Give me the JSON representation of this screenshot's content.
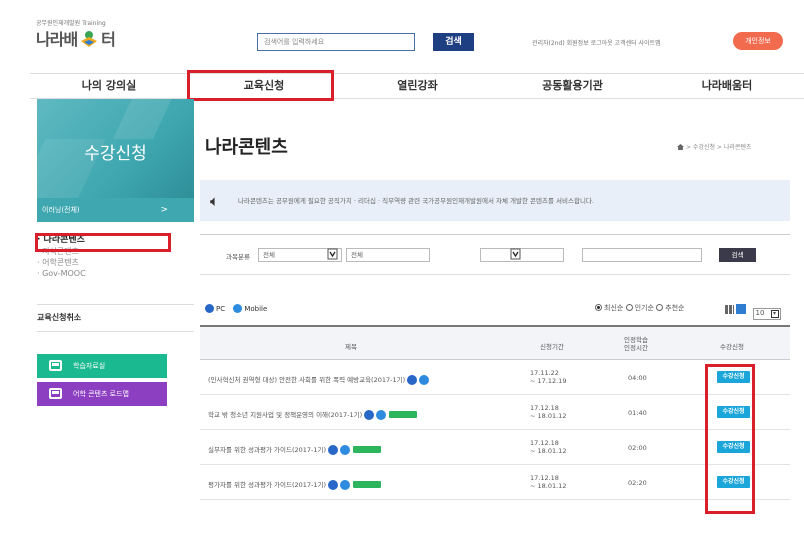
{
  "header": {
    "logo_small": "공무원인재개발원 Training",
    "logo_text_left": "나라배",
    "logo_text_right": "터",
    "search_placeholder": "검색어를 입력하세요",
    "search_button": "검색",
    "top_links": "관리자(2nd) 회원정보 로그아웃 고객센터 사이트맵",
    "login_button": "개인정보"
  },
  "main_nav": [
    "나의 강의실",
    "교육신청",
    "열린강좌",
    "공동활용기관",
    "나라배움터"
  ],
  "sidebar": {
    "banner_title": "수강신청",
    "select_label": "이러닝(전체)",
    "select_chevron": ">",
    "links": [
      "· 나라콘텐츠",
      "· 지식콘텐츠",
      "· 어학콘텐츠",
      "· Gov-MOOC"
    ],
    "cancel_label": "교육신청취소",
    "btn_learning": "학습자료실",
    "btn_language": "어학 콘텐츠 로드맵"
  },
  "content": {
    "page_title": "나라콘텐츠",
    "breadcrumb": "> 수강신청 > 나라콘텐츠",
    "notice": "나라콘텐츠는 공무원에게 필요한 공직가치 · 리더십 · 직무역량 관련 국가공무원인재개발원에서 자체 개발한 콘텐츠를 서비스합니다.",
    "filter_label": "과목분류",
    "filter_select_1": "전체",
    "filter_select_2": "전체",
    "filter_search_btn": "검색",
    "platform_pc": "PC",
    "platform_mobile": "Mobile",
    "sort_options": [
      "최신순",
      "인기순",
      "추천순"
    ],
    "page_size": "10"
  },
  "table": {
    "headers": [
      "제목",
      "신청기간",
      "인정학습\n인정시간",
      "수강신청"
    ],
    "header_time_l1": "인정학습",
    "header_time_l2": "인정시간",
    "rows": [
      {
        "title": "(인사혁신처 권역형 대상) 안전한 사회를 위한 폭력 예방교육(2017-1기)",
        "period_1": "17.11.22",
        "period_2": "~ 17.12.19",
        "time": "04:00",
        "apply": "수강신청",
        "new": false
      },
      {
        "title": "학교 밖 청소년 지원사업 및 정책운영의 이해(2017-1기)",
        "period_1": "17.12.18",
        "period_2": "~ 18.01.12",
        "time": "01:40",
        "apply": "수강신청",
        "new": true
      },
      {
        "title": "실무자를 위한 성과평가 가이드(2017-1기)",
        "period_1": "17.12.18",
        "period_2": "~ 18.01.12",
        "time": "02:00",
        "apply": "수강신청",
        "new": true
      },
      {
        "title": "평가자를 위한 성과평가 가이드(2017-1기)",
        "period_1": "17.12.18",
        "period_2": "~ 18.01.12",
        "time": "02:20",
        "apply": "수강신청",
        "new": true
      }
    ]
  },
  "colors": {
    "highlight_red": "#d9202a",
    "teal": "#3fa7b0",
    "navy": "#1e3f82",
    "apply_blue": "#1aa6d9"
  }
}
